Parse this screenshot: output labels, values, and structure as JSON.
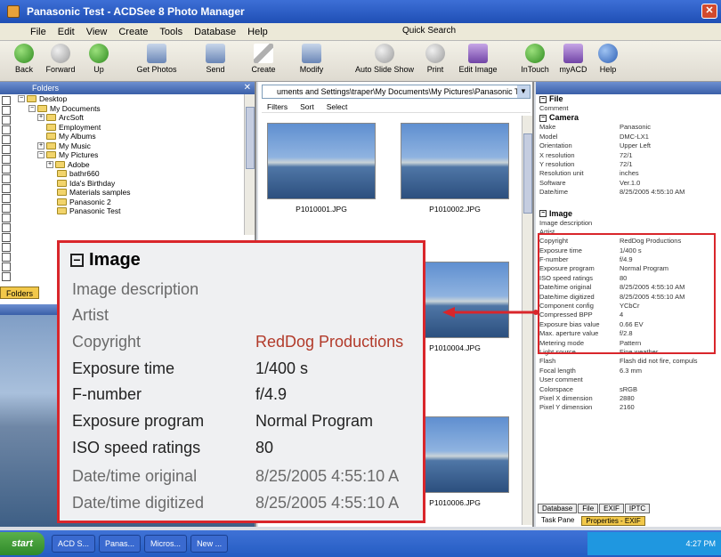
{
  "window": {
    "title": "Panasonic Test - ACDSee 8 Photo Manager"
  },
  "menu": {
    "items": [
      "File",
      "Edit",
      "View",
      "Create",
      "Tools",
      "Database",
      "Help"
    ],
    "quick_search": "Quick Search"
  },
  "toolbar": {
    "back": "Back",
    "forward": "Forward",
    "up": "Up",
    "get_photos": "Get Photos",
    "send": "Send",
    "create": "Create",
    "modify": "Modify",
    "slide_show": "Auto Slide Show",
    "print": "Print",
    "edit_image": "Edit Image",
    "intouch": "InTouch",
    "myacd": "myACD",
    "help": "Help"
  },
  "folders": {
    "panel_title": "Folders",
    "tab_label": "Folders",
    "tree": [
      "Desktop",
      "My Documents",
      "ArcSoft",
      "Employment",
      "My Albums",
      "My Music",
      "My Pictures",
      "Adobe",
      "bathr660",
      "Ida's Birthday",
      "Materials samples",
      "Panasonic 2",
      "Panasonic Test"
    ]
  },
  "browser": {
    "address": "uments and Settings\\traper\\My Documents\\My Pictures\\Panasonic Test",
    "filters": "Filters",
    "sort": "Sort",
    "select": "Select",
    "thumbs": [
      "P1010001.JPG",
      "P1010002.JPG",
      "P1010004.JPG",
      "P1010006.JPG"
    ]
  },
  "properties": {
    "file_section": "File",
    "comment_key": "Comment",
    "camera_section": "Camera",
    "camera_rows": [
      {
        "k": "Make",
        "v": "Panasonic"
      },
      {
        "k": "Model",
        "v": "DMC-LX1"
      },
      {
        "k": "Orientation",
        "v": "Upper Left"
      },
      {
        "k": "X resolution",
        "v": "72/1"
      },
      {
        "k": "Y resolution",
        "v": "72/1"
      },
      {
        "k": "Resolution unit",
        "v": "inches"
      },
      {
        "k": "Software",
        "v": "Ver.1.0"
      },
      {
        "k": "Date/time",
        "v": "8/25/2005 4:55:10 AM"
      }
    ],
    "image_section": "Image",
    "image_rows": [
      {
        "k": "Image description",
        "v": ""
      },
      {
        "k": "Artist",
        "v": ""
      },
      {
        "k": "Copyright",
        "v": "RedDog Productions"
      },
      {
        "k": "Exposure time",
        "v": "1/400 s"
      },
      {
        "k": "F-number",
        "v": "f/4.9"
      },
      {
        "k": "Exposure program",
        "v": "Normal Program"
      },
      {
        "k": "ISO speed ratings",
        "v": "80"
      },
      {
        "k": "Date/time original",
        "v": "8/25/2005 4:55:10 AM"
      },
      {
        "k": "Date/time digitized",
        "v": "8/25/2005 4:55:10 AM"
      }
    ],
    "more_rows": [
      {
        "k": "Component config",
        "v": "YCbCr"
      },
      {
        "k": "Compressed BPP",
        "v": "4"
      },
      {
        "k": "Exposure bias value",
        "v": "0.66 EV"
      },
      {
        "k": "Max. aperture value",
        "v": "f/2.8"
      },
      {
        "k": "Metering mode",
        "v": "Pattern"
      },
      {
        "k": "Light source",
        "v": "Fine weather"
      },
      {
        "k": "Flash",
        "v": "Flash did not fire, compuls"
      },
      {
        "k": "Focal length",
        "v": "6.3 mm"
      },
      {
        "k": "User comment",
        "v": ""
      },
      {
        "k": "Colorspace",
        "v": "sRGB"
      },
      {
        "k": "Pixel X dimension",
        "v": "2880"
      },
      {
        "k": "Pixel Y dimension",
        "v": "2160"
      }
    ],
    "tabs": [
      "Database",
      "File",
      "EXIF",
      "IPTC"
    ],
    "bottom_tabs": [
      "Task Pane",
      "Properties - EXIF"
    ]
  },
  "magnified": {
    "section": "Image",
    "rows": [
      {
        "k": "Image description",
        "v": ""
      },
      {
        "k": "Artist",
        "v": ""
      },
      {
        "k": "Copyright",
        "v": "RedDog Productions"
      },
      {
        "k": "Exposure time",
        "v": "1/400 s"
      },
      {
        "k": "F-number",
        "v": "f/4.9"
      },
      {
        "k": "Exposure program",
        "v": "Normal Program"
      },
      {
        "k": "ISO speed ratings",
        "v": "80"
      },
      {
        "k": "Date/time original",
        "v": "8/25/2005 4:55:10 A"
      },
      {
        "k": "Date/time digitized",
        "v": "8/25/2005 4:55:10 A"
      }
    ]
  },
  "taskbar": {
    "start": "start",
    "items": [
      "ACD S...",
      "Panas...",
      "Micros...",
      "New ..."
    ],
    "clock": "4:27 PM"
  },
  "colors": {
    "highlight": "#d9262b",
    "accent_value": "#b23a2a"
  }
}
